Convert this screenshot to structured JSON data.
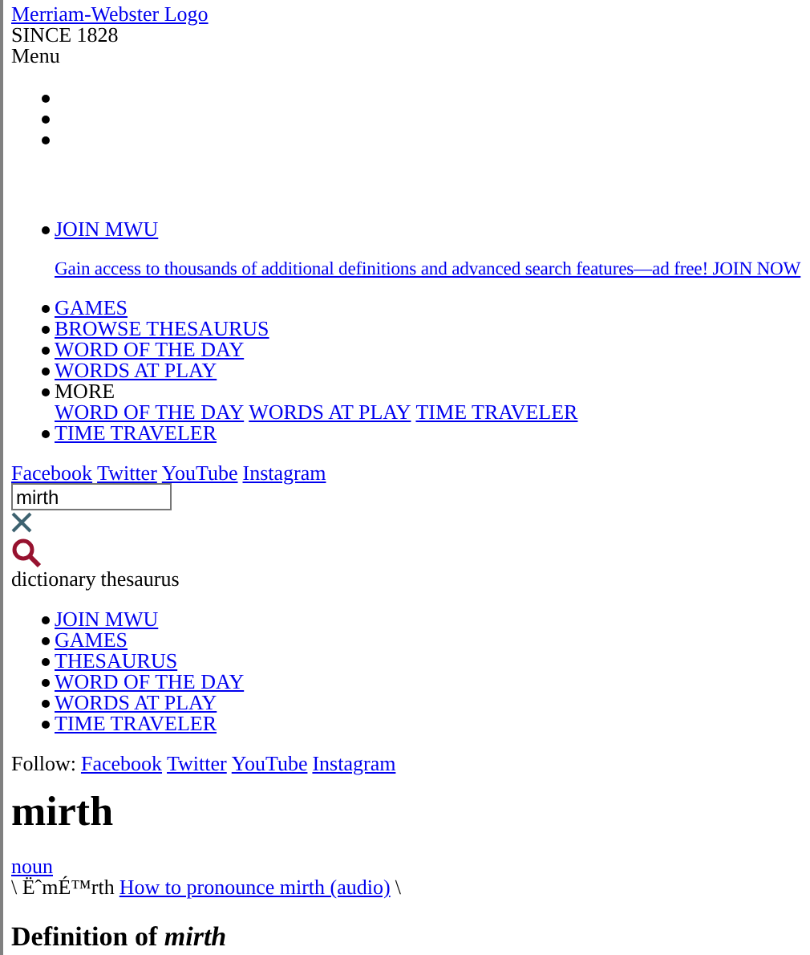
{
  "header": {
    "logo_link": "Merriam-Webster Logo",
    "tagline": "SINCE 1828",
    "menu_label": "Menu"
  },
  "menu_bullets": [
    {
      "kind": "empty"
    },
    {
      "kind": "empty"
    },
    {
      "kind": "empty"
    }
  ],
  "nav": [
    {
      "kind": "promo",
      "label": "JOIN MWU",
      "promo": "Gain access to thousands of additional definitions and advanced search features—ad free! JOIN NOW"
    },
    {
      "kind": "link",
      "label": "GAMES"
    },
    {
      "kind": "link",
      "label": "BROWSE THESAURUS"
    },
    {
      "kind": "link",
      "label": "WORD OF THE DAY"
    },
    {
      "kind": "link",
      "label": "WORDS AT PLAY"
    },
    {
      "kind": "submenu",
      "label": "MORE",
      "children": [
        "WORD OF THE DAY",
        "WORDS AT PLAY",
        "TIME TRAVELER"
      ]
    },
    {
      "kind": "link",
      "label": "TIME TRAVELER"
    }
  ],
  "social_links": [
    "Facebook",
    "Twitter",
    "YouTube",
    "Instagram"
  ],
  "search": {
    "value": "mirth"
  },
  "search_tabs": [
    "dictionary",
    "thesaurus"
  ],
  "mobile_nav": [
    "JOIN MWU",
    "GAMES",
    "THESAURUS",
    "WORD OF THE DAY",
    "WORDS AT PLAY",
    "TIME TRAVELER"
  ],
  "follow": {
    "label": "Follow:",
    "links": [
      "Facebook",
      "Twitter",
      "YouTube",
      "Instagram"
    ]
  },
  "entry": {
    "headword": "mirth",
    "part_of_speech": "noun",
    "pronunciation": "\\ ËˆmÉ™rth",
    "audio_link": "How to pronounce mirth (audio)",
    "pronunciation_end": "\\",
    "definition_heading": "Definition of *mirth*"
  }
}
